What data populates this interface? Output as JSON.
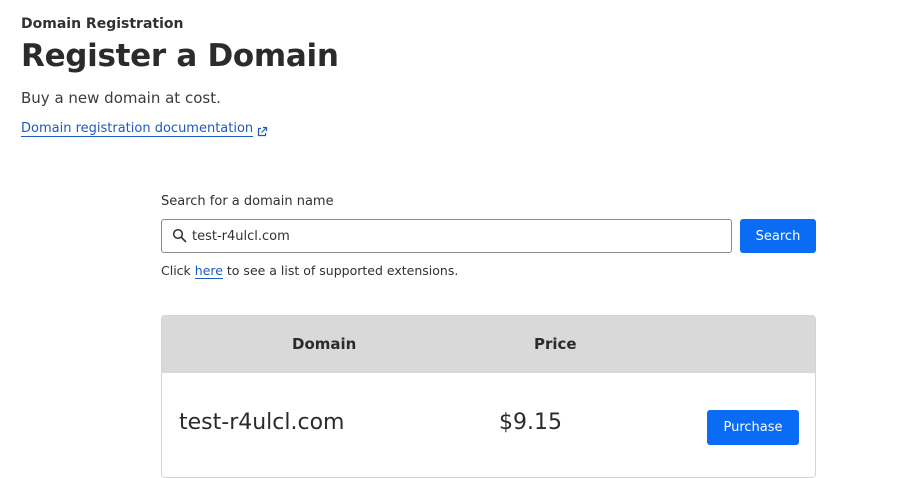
{
  "header": {
    "breadcrumb": "Domain Registration",
    "title": "Register a Domain",
    "subtitle": "Buy a new domain at cost.",
    "doc_link_label": "Domain registration documentation",
    "doc_link_icon": "external-link-icon"
  },
  "search": {
    "label": "Search for a domain name",
    "value": "test-r4ulcl.com",
    "icon": "search-icon",
    "button_label": "Search",
    "hint_prefix": "Click ",
    "hint_link": "here",
    "hint_suffix": " to see a list of supported extensions."
  },
  "results": {
    "columns": [
      "Domain",
      "Price"
    ],
    "rows": [
      {
        "domain": "test-r4ulcl.com",
        "price": "$9.15",
        "action_label": "Purchase"
      }
    ]
  },
  "colors": {
    "accent": "#0a6cf5",
    "link": "#1d5bbf",
    "table_header_bg": "#d9d9d9"
  }
}
